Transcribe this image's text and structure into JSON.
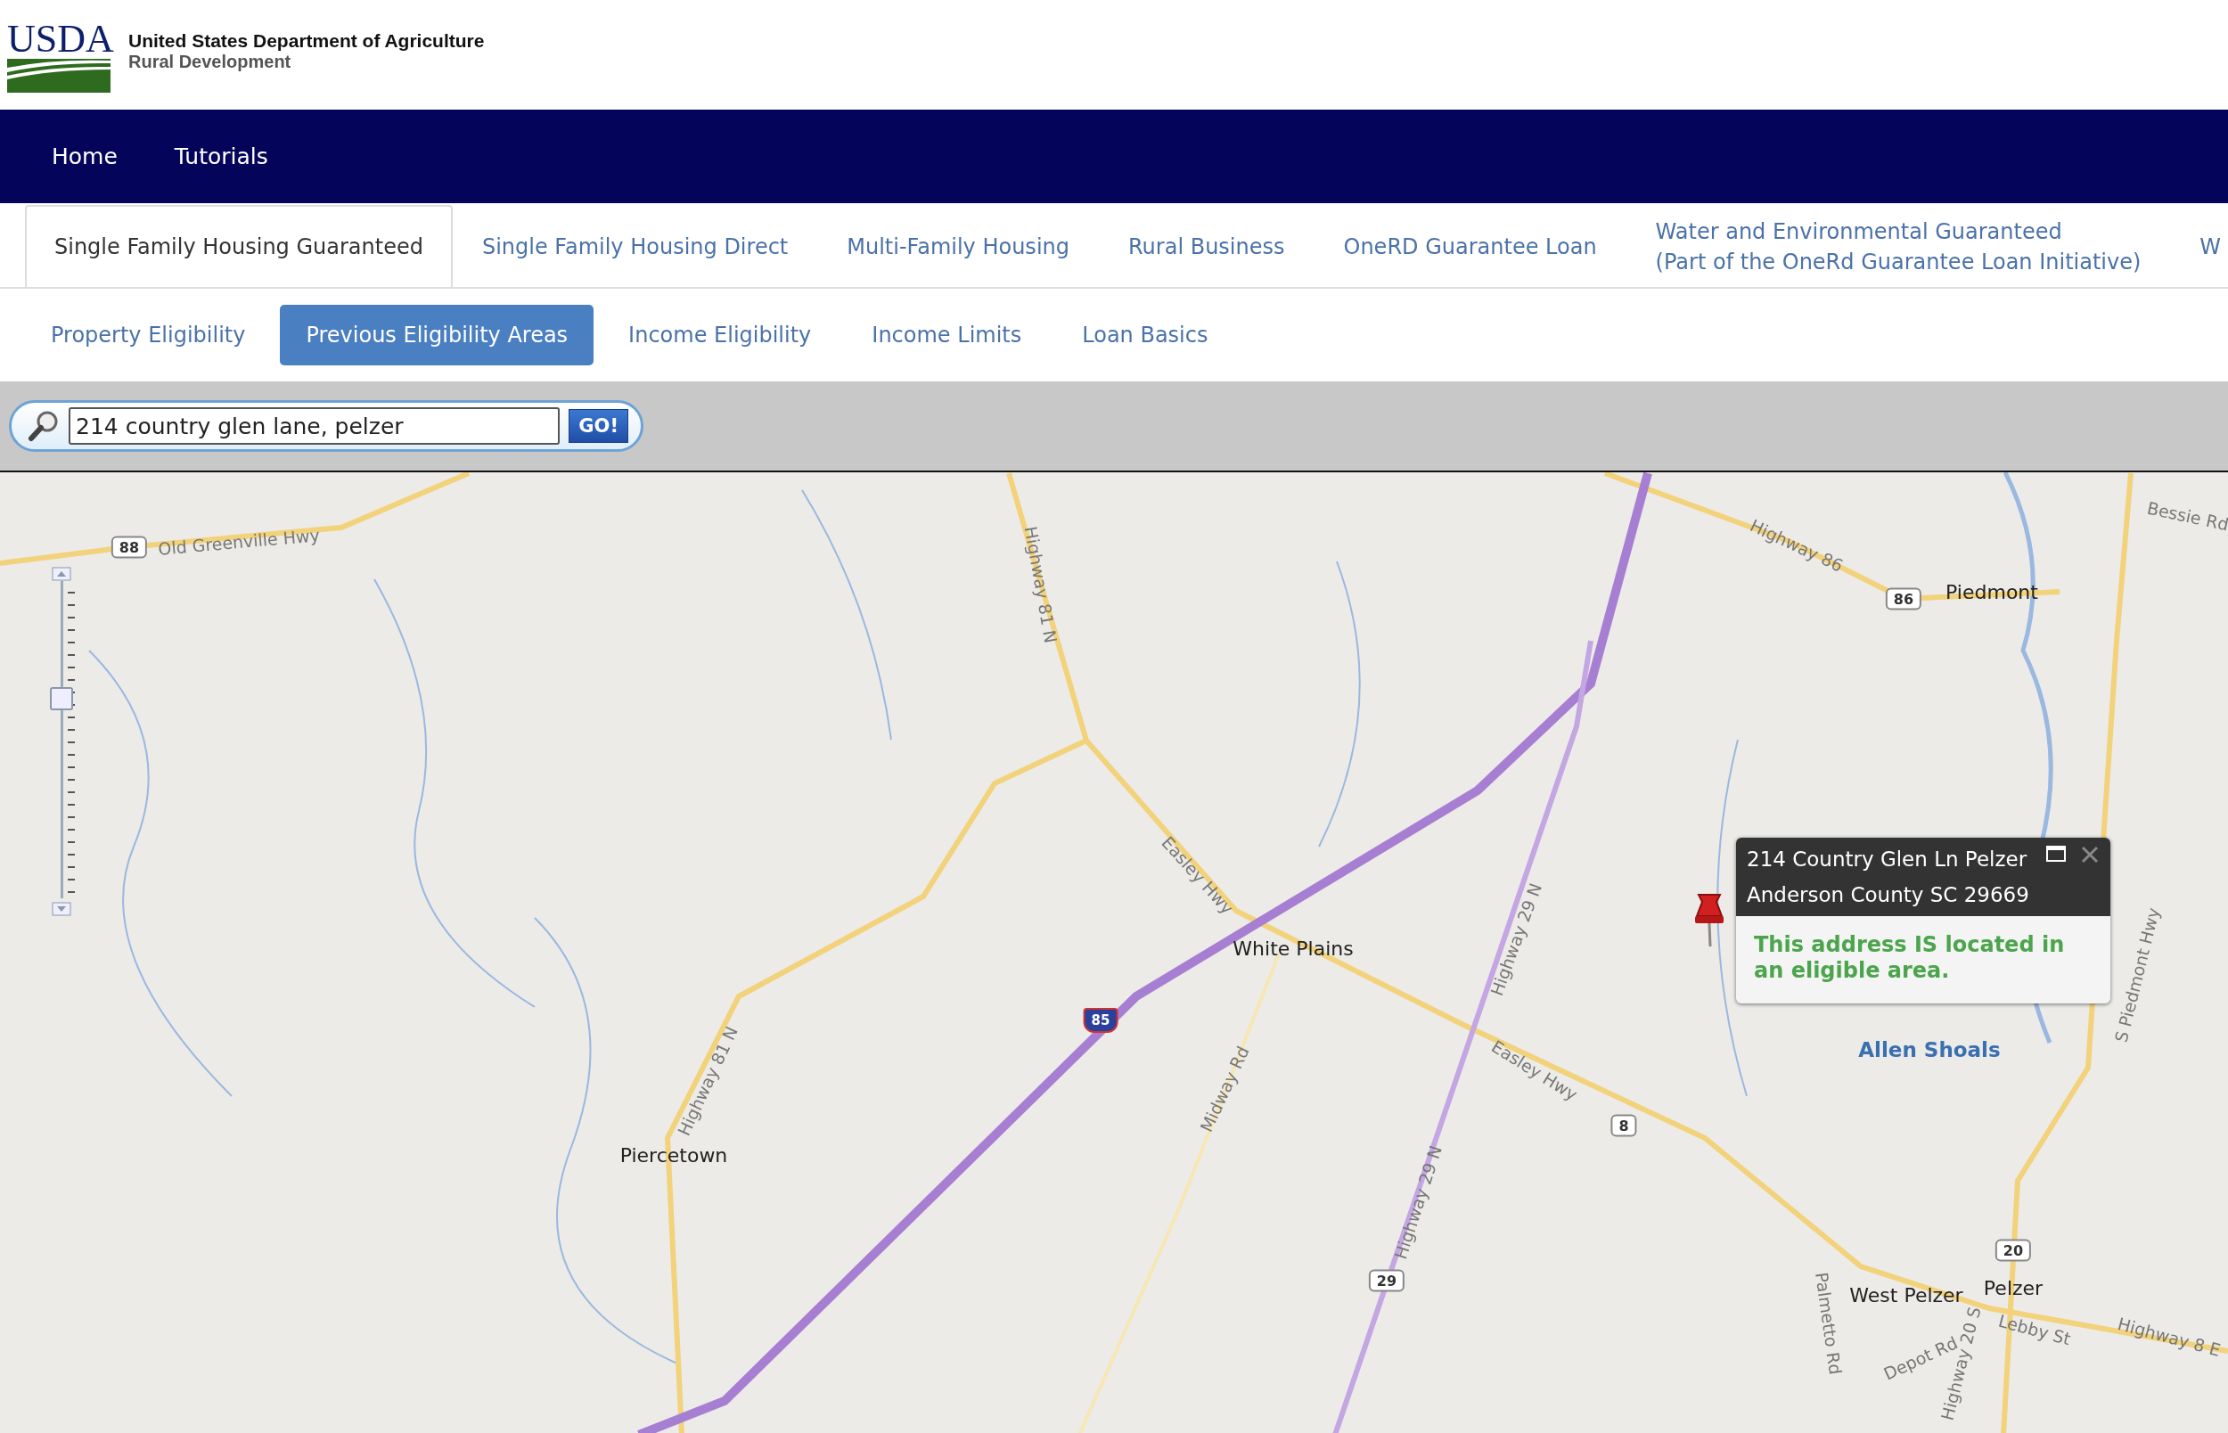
{
  "header": {
    "logo_text": "USDA",
    "agency": "United States Department of Agriculture",
    "division": "Rural Development"
  },
  "nav": [
    {
      "label": "Home"
    },
    {
      "label": "Tutorials"
    }
  ],
  "program_tabs": [
    {
      "label": "Single Family Housing Guaranteed",
      "selected": true
    },
    {
      "label": "Single Family Housing Direct",
      "selected": false
    },
    {
      "label": "Multi-Family Housing",
      "selected": false
    },
    {
      "label": "Rural Business",
      "selected": false
    },
    {
      "label": "OneRD Guarantee Loan",
      "selected": false
    },
    {
      "label": "Water and Environmental Guaranteed\n(Part of the OneRd Guarantee Loan Initiative)",
      "selected": false
    },
    {
      "label": "W",
      "selected": false
    }
  ],
  "sub_tabs": [
    {
      "label": "Property Eligibility",
      "selected": false
    },
    {
      "label": "Previous Eligibility Areas",
      "selected": true
    },
    {
      "label": "Income Eligibility",
      "selected": false
    },
    {
      "label": "Income Limits",
      "selected": false
    },
    {
      "label": "Loan Basics",
      "selected": false
    }
  ],
  "search": {
    "value": "214 country glen lane, pelzer",
    "button": "GO!"
  },
  "map": {
    "zoom_slider": {
      "level": 0.64
    },
    "labels": [
      {
        "text": "88",
        "kind": "shield"
      },
      {
        "text": "Old Greenville Hwy",
        "kind": "road"
      },
      {
        "text": "Highway 81 N",
        "kind": "road"
      },
      {
        "text": "Highway 86",
        "kind": "road"
      },
      {
        "text": "86",
        "kind": "shield"
      },
      {
        "text": "Piedmont",
        "kind": "place"
      },
      {
        "text": "Bessie Rd",
        "kind": "road"
      },
      {
        "text": "Easley Hwy",
        "kind": "road"
      },
      {
        "text": "White Plains",
        "kind": "place"
      },
      {
        "text": "Highway 29 N",
        "kind": "road"
      },
      {
        "text": "85",
        "kind": "interstate"
      },
      {
        "text": "Highway 81 N",
        "kind": "road"
      },
      {
        "text": "Midway Rd",
        "kind": "road"
      },
      {
        "text": "Easley Hwy",
        "kind": "road"
      },
      {
        "text": "8",
        "kind": "shield"
      },
      {
        "text": "Allen Shoals",
        "kind": "water"
      },
      {
        "text": "S Piedmont Hwy",
        "kind": "road"
      },
      {
        "text": "Piercetown",
        "kind": "place"
      },
      {
        "text": "Highway 29 N",
        "kind": "road"
      },
      {
        "text": "29",
        "kind": "shield"
      },
      {
        "text": "20",
        "kind": "shield"
      },
      {
        "text": "Pelzer",
        "kind": "place"
      },
      {
        "text": "West Pelzer",
        "kind": "place"
      },
      {
        "text": "Palmetto Rd",
        "kind": "road"
      },
      {
        "text": "Lebby St",
        "kind": "road"
      },
      {
        "text": "Highway 8 E",
        "kind": "road"
      },
      {
        "text": "Depot Rd",
        "kind": "road"
      },
      {
        "text": "Highway 20 S",
        "kind": "road"
      }
    ],
    "popup": {
      "title_lines": [
        "214 Country Glen Ln Pelzer",
        "Anderson County SC 29669"
      ],
      "message": "This address IS located in an eligible area."
    }
  }
}
